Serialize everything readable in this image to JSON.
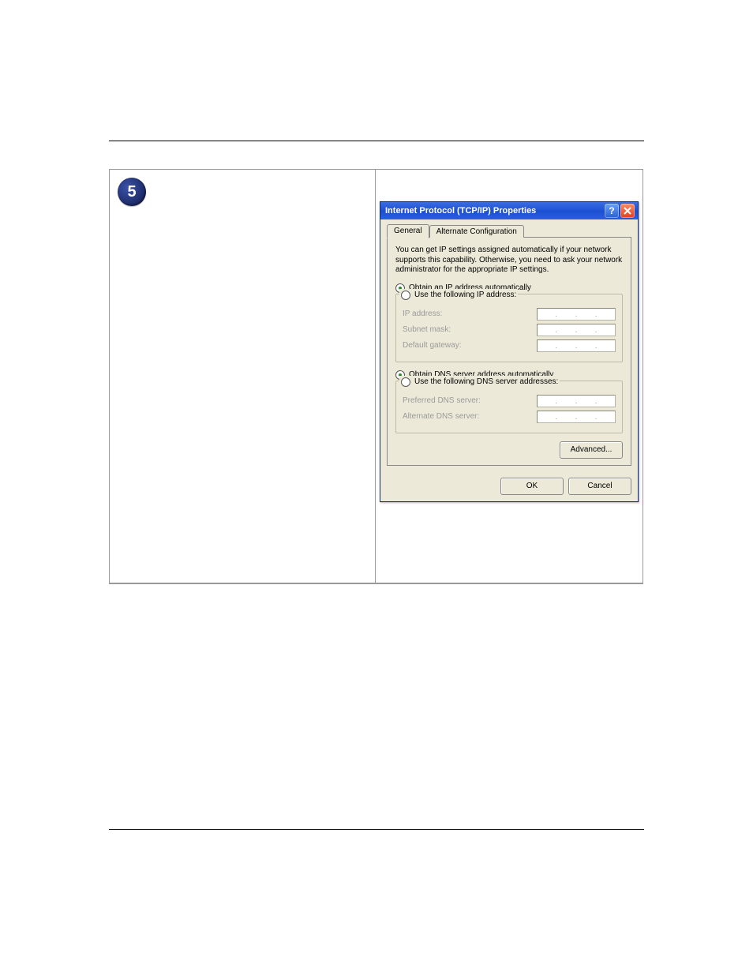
{
  "step_number": "5",
  "dialog": {
    "title": "Internet Protocol (TCP/IP) Properties",
    "tabs": {
      "general": "General",
      "alt": "Alternate Configuration"
    },
    "info": "You can get IP settings assigned automatically if your network supports this capability. Otherwise, you need to ask your network administrator for the appropriate IP settings.",
    "radio_ip_auto": "Obtain an IP address automatically",
    "radio_ip_manual": "Use the following IP address:",
    "labels": {
      "ip": "IP address:",
      "subnet": "Subnet mask:",
      "gateway": "Default gateway:",
      "pref_dns": "Preferred DNS server:",
      "alt_dns": "Alternate DNS server:"
    },
    "radio_dns_auto": "Obtain DNS server address automatically",
    "radio_dns_manual": "Use the following DNS server addresses:",
    "buttons": {
      "advanced": "Advanced...",
      "ok": "OK",
      "cancel": "Cancel"
    }
  }
}
